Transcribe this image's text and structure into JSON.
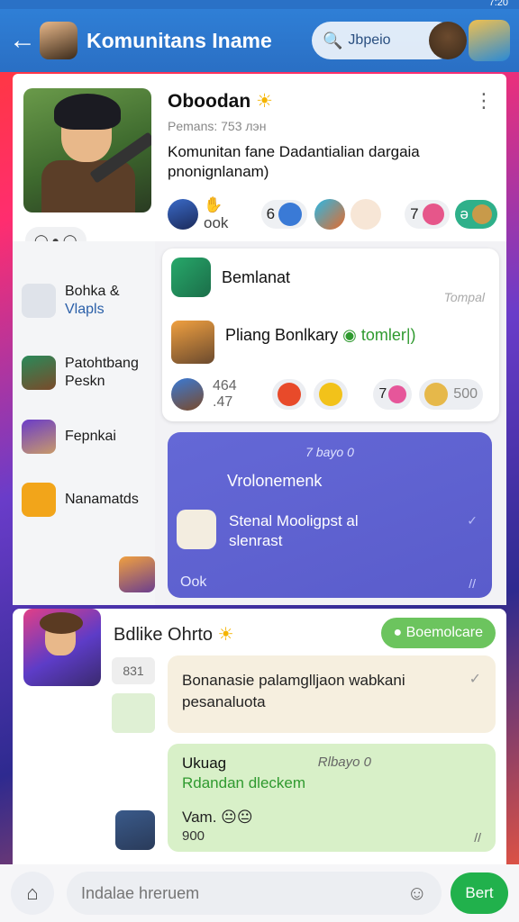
{
  "status": {
    "time": "7:20"
  },
  "header": {
    "back_icon": "arrow-left-icon",
    "title": "Komunitans Iname",
    "search_placeholder": "Jbpeio"
  },
  "group": {
    "name": "Oboodan",
    "members": "Pemans: 753 лэн",
    "description": "Komunitan fane Dadantialian dargaia pnonignlanam)",
    "reaction_label": "ook",
    "count_a": "6",
    "count_b": "7",
    "count_c": "ә"
  },
  "nav": {
    "items": [
      {
        "label": "Bohka &",
        "sub": "Vlapls"
      },
      {
        "label": "Patohtbang",
        "sub": "Peskn"
      },
      {
        "label": "Fepnkai",
        "sub": ""
      },
      {
        "label": "Nanamatds",
        "sub": ""
      }
    ]
  },
  "post1": {
    "title": "Bemlanat",
    "time": "Tompal",
    "text": "Pliang Bonlkary",
    "green_text": "tomler|)",
    "react_count": "464 .47",
    "count_b": "7",
    "count_c": "500"
  },
  "post2": {
    "time": "7 bayo 0",
    "title": "Vrolonemenk",
    "text": "Stenal Mooligpst al slenrast",
    "footer": "Ook"
  },
  "post3": {
    "name": "Bdlike Ohrto",
    "badge": "Boemolcare",
    "small_label": "831",
    "cream_text": "Bonanasie palamglljaon wabkani pesanaluota",
    "green_title": "Ukuag",
    "green_time": "Rlbayo 0",
    "green_sub": "Rdandan dleckem",
    "vam_label": "Vam.",
    "green_num": "900"
  },
  "composer": {
    "placeholder": "Indalae hreruem",
    "send_label": "Bert"
  },
  "colors": {
    "appbar": "#2a71c6",
    "send": "#21b14c",
    "purple": "#5a5ccb"
  }
}
